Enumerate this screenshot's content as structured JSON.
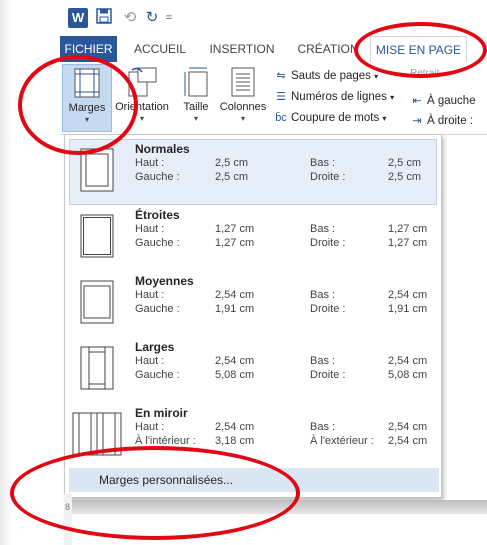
{
  "title_bar": {
    "app_icon_label": "W",
    "save_icon": "save-icon",
    "undo_icon": "undo-icon",
    "redo_icon": "redo-icon",
    "customize_icon": "customize-qat-icon",
    "undo_glyph": "⟲",
    "redo_glyph": "↻",
    "customize_glyph": "="
  },
  "tabs": {
    "file": "FICHIER",
    "home": "ACCUEIL",
    "insert": "INSERTION",
    "design": "CRÉATION",
    "layout": "MISE EN PAGE"
  },
  "ribbon": {
    "margins_label": "Marges",
    "orientation_label": "Orientation",
    "size_label": "Taille",
    "columns_label": "Colonnes",
    "breaks_label": "Sauts de pages",
    "line_numbers_label": "Numéros de lignes",
    "hyphenation_label": "Coupure de mots",
    "indent_group_label": "Retrait",
    "indent_left_label": "À gauche",
    "indent_right_label": "À droite :",
    "caret": "▾"
  },
  "margins_menu": {
    "items": [
      {
        "name": "Normales",
        "k1": "Haut :",
        "v1": "2,5 cm",
        "k2": "Bas :",
        "v2": "2,5 cm",
        "k3": "Gauche :",
        "v3": "2,5 cm",
        "k4": "Droite :",
        "v4": "2,5 cm"
      },
      {
        "name": "Étroites",
        "k1": "Haut :",
        "v1": "1,27 cm",
        "k2": "Bas :",
        "v2": "1,27 cm",
        "k3": "Gauche :",
        "v3": "1,27 cm",
        "k4": "Droite :",
        "v4": "1,27 cm"
      },
      {
        "name": "Moyennes",
        "k1": "Haut :",
        "v1": "2,54 cm",
        "k2": "Bas :",
        "v2": "2,54 cm",
        "k3": "Gauche :",
        "v3": "1,91 cm",
        "k4": "Droite :",
        "v4": "1,91 cm"
      },
      {
        "name": "Larges",
        "k1": "Haut :",
        "v1": "2,54 cm",
        "k2": "Bas :",
        "v2": "2,54 cm",
        "k3": "Gauche :",
        "v3": "5,08 cm",
        "k4": "Droite :",
        "v4": "5,08 cm"
      },
      {
        "name": "En miroir",
        "k1": "Haut :",
        "v1": "2,54 cm",
        "k2": "Bas :",
        "v2": "2,54 cm",
        "k3": "À l'intérieur :",
        "v3": "3,18 cm",
        "k4": "À l'extérieur :",
        "v4": "2,54 cm"
      }
    ],
    "custom_label": "Marges personnalisées..."
  },
  "ruler": {
    "mark": "8"
  },
  "colors": {
    "accent": "#2b579a",
    "annotation": "#e30613",
    "selected_item": "#e5eef9"
  }
}
